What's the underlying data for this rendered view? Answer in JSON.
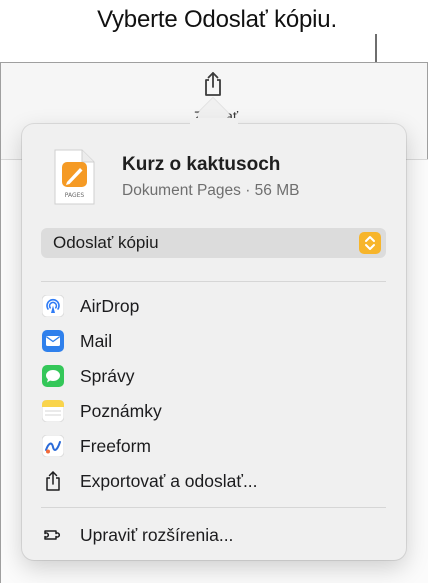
{
  "callout": {
    "text": "Vyberte Odoslať kópiu."
  },
  "toolbar": {
    "share_label": "Zdieľať"
  },
  "document": {
    "title": "Kurz o kaktusoch",
    "subtitle": "Dokument Pages · 56 MB",
    "icon_caption": "PAGES"
  },
  "send_select": {
    "value": "Odoslať kópiu"
  },
  "share_options": [
    {
      "label": "AirDrop",
      "icon": "airdrop-icon",
      "color": "#2f7cf6"
    },
    {
      "label": "Mail",
      "icon": "mail-icon",
      "color": "#2f80ec"
    },
    {
      "label": "Správy",
      "icon": "messages-icon",
      "color": "#34c759"
    },
    {
      "label": "Poznámky",
      "icon": "notes-icon",
      "color": "#f9d44b"
    },
    {
      "label": "Freeform",
      "icon": "freeform-icon",
      "color": "#2b6bd8"
    },
    {
      "label": "Exportovať a odoslať...",
      "icon": "export-icon",
      "color": "#1c1c1e"
    }
  ],
  "extensions": {
    "label": "Upraviť rozšírenia...",
    "icon": "extensions-icon"
  },
  "colors": {
    "accent": "#f7b52b",
    "popover_bg": "#f0f0f0"
  }
}
